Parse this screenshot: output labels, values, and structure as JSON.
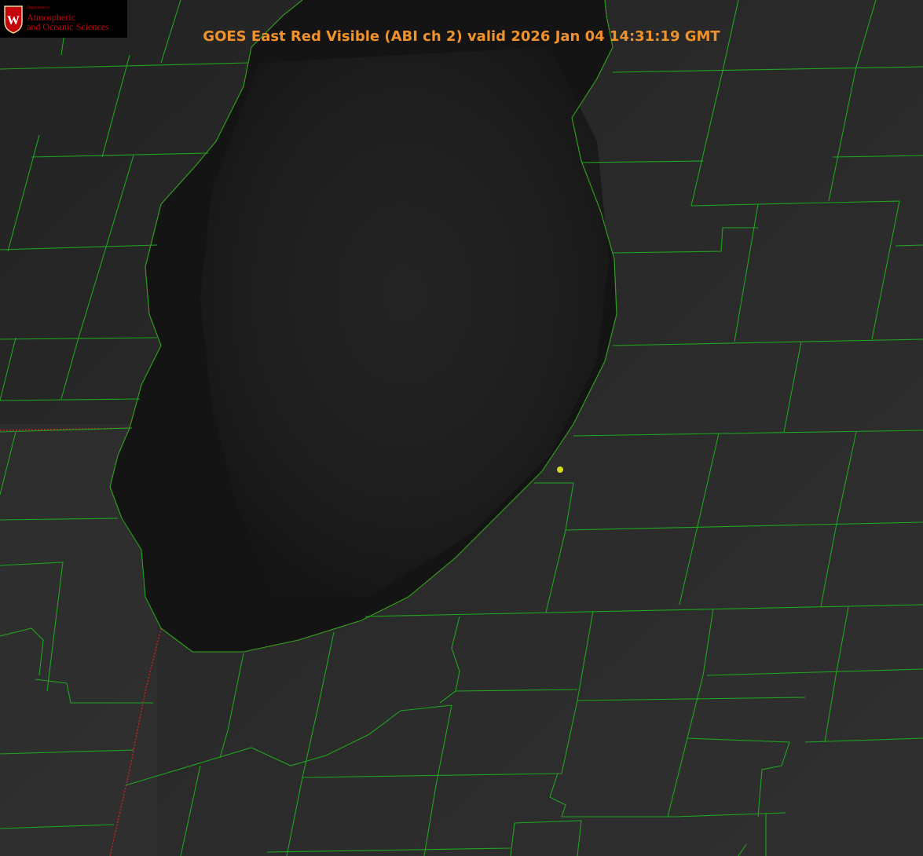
{
  "title": "GOES East Red Visible (ABI ch 2) valid 2026 Jan 04 14:31:19 GMT",
  "logo": {
    "dept_text": "Department of",
    "line1": "Atmospheric",
    "line2": "and Oceanic Sciences",
    "crest_letter": "W",
    "crest_icon": "uw-crest-icon"
  },
  "colors": {
    "county_lines": "#1fa51f",
    "state_line": "#d92020",
    "marker": "#d8d820",
    "title": "#f0922b",
    "logo_red": "#c5050c"
  }
}
